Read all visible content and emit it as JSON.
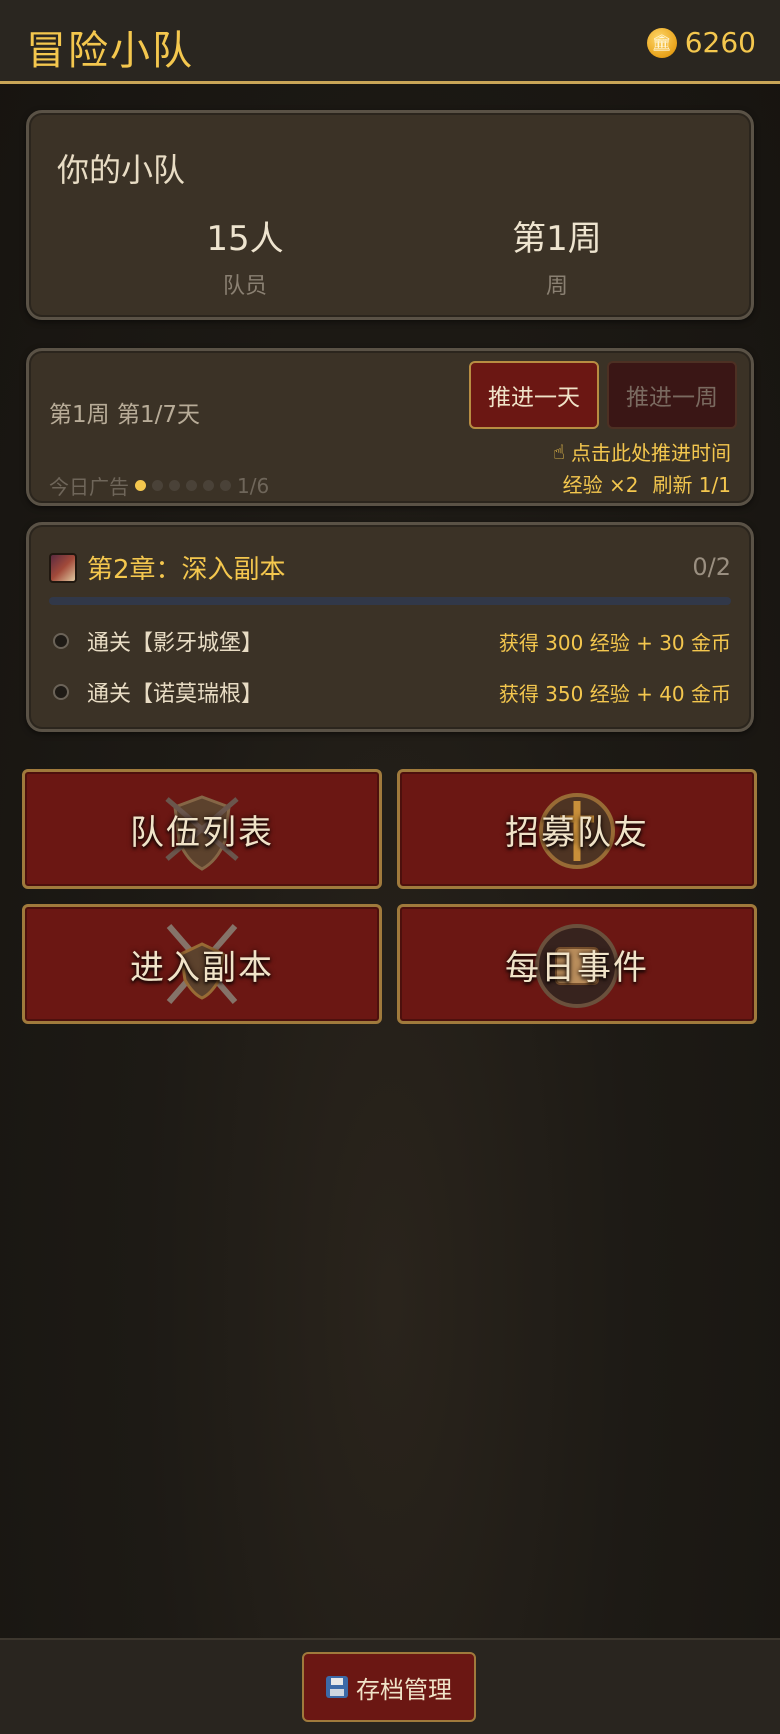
{
  "header": {
    "title": "冒险小队",
    "coins": "6260",
    "coin_icon": "coin-icon"
  },
  "squad": {
    "title": "你的小队",
    "members_value": "15人",
    "members_label": "队员",
    "week_value": "第1周",
    "week_label": "周"
  },
  "time": {
    "status": "第1周 第1/7天",
    "advance_day": "推进一天",
    "advance_week": "推进一周",
    "hint": "点击此处推进时间",
    "ads_label": "今日广告",
    "ads_progress": "1/6",
    "ads_used": 1,
    "ads_total": 6,
    "exp_bonus": "经验 ×2",
    "refresh": "刷新 1/1"
  },
  "quest": {
    "title": "第2章：深入副本",
    "progress": "0/2",
    "progress_fraction": 0,
    "items": [
      {
        "name": "通关【影牙城堡】",
        "reward": "获得 300 经验 + 30 金币"
      },
      {
        "name": "通关【诺莫瑞根】",
        "reward": "获得 350 经验 + 40 金币"
      }
    ]
  },
  "menu": {
    "team_list": "队伍列表",
    "recruit": "招募队友",
    "dungeon": "进入副本",
    "daily_events": "每日事件"
  },
  "footer": {
    "save_manage": "存档管理"
  },
  "colors": {
    "accent_gold": "#f4c74e",
    "button_red": "#6b1713",
    "card_bg": "#3b3226"
  }
}
